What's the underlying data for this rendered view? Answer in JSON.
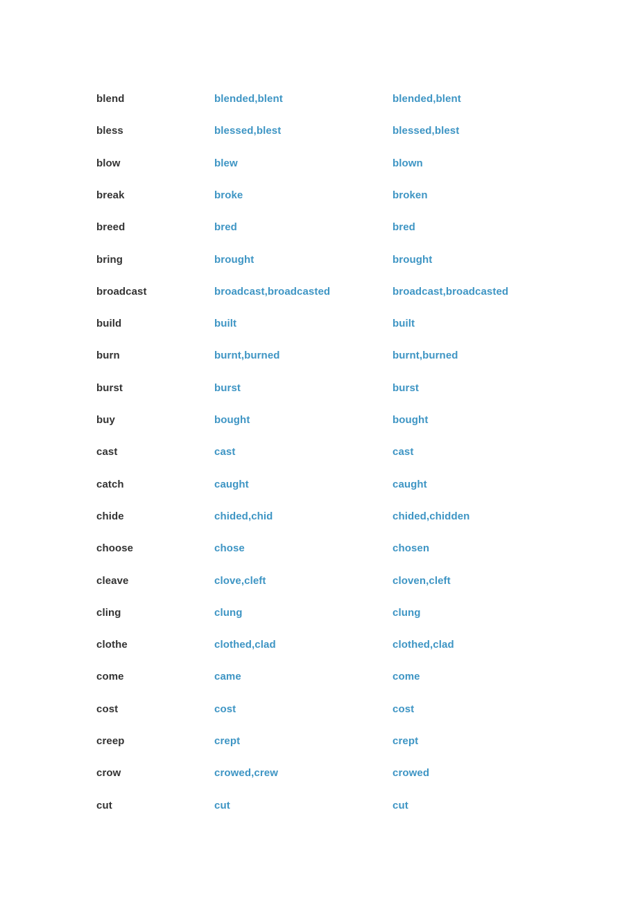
{
  "page": {
    "background_color": "#ffffff",
    "base_form_color": "#333333",
    "inflected_color": "#3e95c4"
  },
  "table": {
    "columns": [
      "base",
      "past_simple",
      "past_participle"
    ],
    "rows": [
      {
        "base": "blend",
        "past_simple": "blended,blent",
        "past_participle": "blended,blent"
      },
      {
        "base": "bless",
        "past_simple": "blessed,blest",
        "past_participle": "blessed,blest"
      },
      {
        "base": "blow",
        "past_simple": "blew",
        "past_participle": "blown"
      },
      {
        "base": "break",
        "past_simple": "broke",
        "past_participle": "broken"
      },
      {
        "base": "breed",
        "past_simple": "bred",
        "past_participle": "bred"
      },
      {
        "base": "bring",
        "past_simple": "brought",
        "past_participle": "brought"
      },
      {
        "base": "broadcast",
        "past_simple": "broadcast,broadcasted",
        "past_participle": "broadcast,broadcasted"
      },
      {
        "base": "build",
        "past_simple": "built",
        "past_participle": "built"
      },
      {
        "base": "burn",
        "past_simple": "burnt,burned",
        "past_participle": "burnt,burned"
      },
      {
        "base": "burst",
        "past_simple": "burst",
        "past_participle": "burst"
      },
      {
        "base": "buy",
        "past_simple": "bought",
        "past_participle": "bought"
      },
      {
        "base": "cast",
        "past_simple": "cast",
        "past_participle": "cast"
      },
      {
        "base": "catch",
        "past_simple": "caught",
        "past_participle": "caught"
      },
      {
        "base": "chide",
        "past_simple": "chided,chid",
        "past_participle": "chided,chidden"
      },
      {
        "base": "choose",
        "past_simple": "chose",
        "past_participle": "chosen"
      },
      {
        "base": "cleave",
        "past_simple": "clove,cleft",
        "past_participle": "cloven,cleft"
      },
      {
        "base": "cling",
        "past_simple": "clung",
        "past_participle": "clung"
      },
      {
        "base": "clothe",
        "past_simple": "clothed,clad",
        "past_participle": "clothed,clad"
      },
      {
        "base": "come",
        "past_simple": "came",
        "past_participle": "come"
      },
      {
        "base": "cost",
        "past_simple": "cost",
        "past_participle": "cost"
      },
      {
        "base": "creep",
        "past_simple": "crept",
        "past_participle": "crept"
      },
      {
        "base": "crow",
        "past_simple": "crowed,crew",
        "past_participle": "crowed"
      },
      {
        "base": "cut",
        "past_simple": "cut",
        "past_participle": "cut"
      }
    ]
  }
}
